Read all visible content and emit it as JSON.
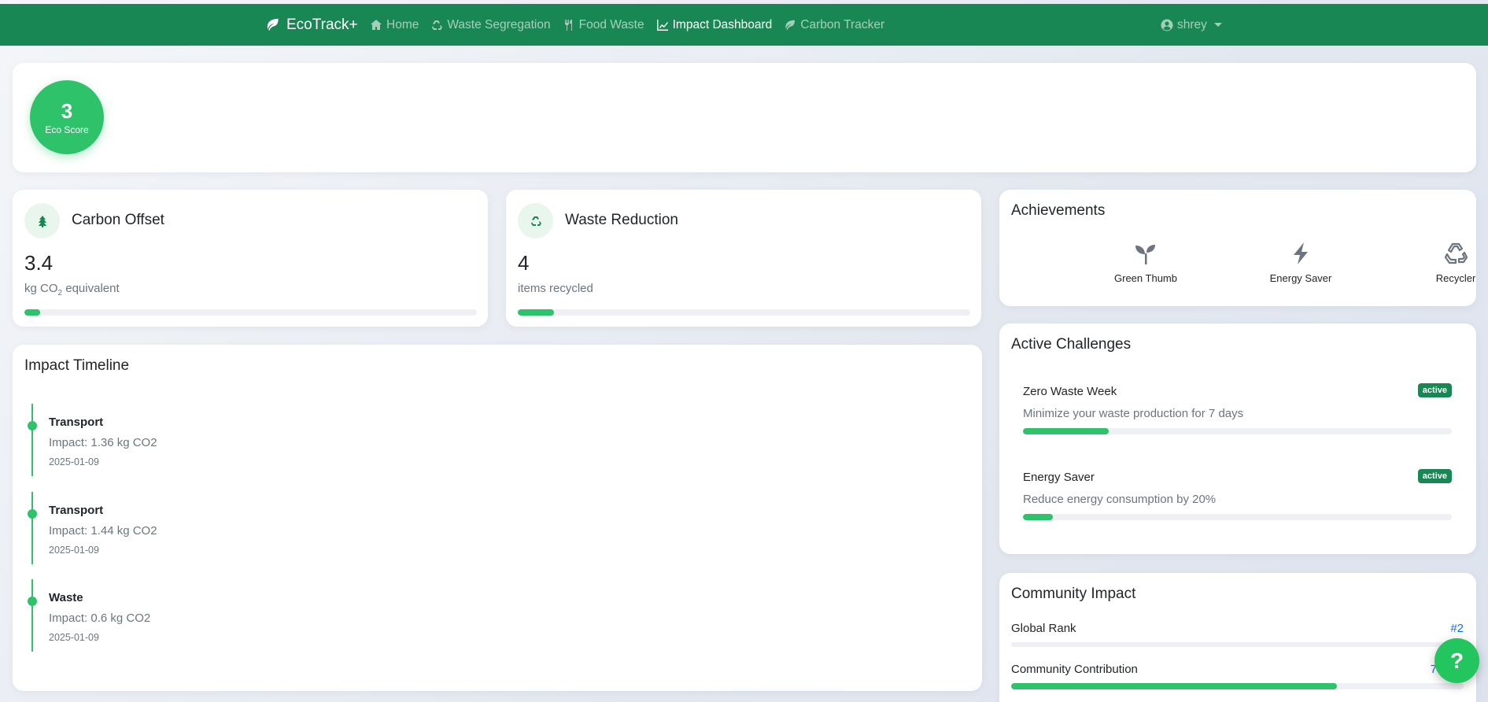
{
  "nav": {
    "brand": "EcoTrack+",
    "links": [
      {
        "label": "Home"
      },
      {
        "label": "Waste Segregation"
      },
      {
        "label": "Food Waste"
      },
      {
        "label": "Impact Dashboard"
      },
      {
        "label": "Carbon Tracker"
      }
    ],
    "user": "shrey"
  },
  "eco_score": {
    "value": "3",
    "label": "Eco Score"
  },
  "carbon_offset": {
    "title": "Carbon Offset",
    "value": "3.4",
    "unit_prefix": "kg CO",
    "unit_sub": "2",
    "unit_suffix": " equivalent",
    "progress_fraction": 0.034
  },
  "waste_reduction": {
    "title": "Waste Reduction",
    "value": "4",
    "unit": "items recycled",
    "progress_fraction": 0.08
  },
  "achievements": {
    "title": "Achievements",
    "items": [
      {
        "label": "Green Thumb",
        "icon": "seedling-icon"
      },
      {
        "label": "Energy Saver",
        "icon": "bolt-icon"
      },
      {
        "label": "Recycler",
        "icon": "recycle-icon"
      }
    ]
  },
  "timeline": {
    "title": "Impact Timeline",
    "items": [
      {
        "title": "Transport",
        "impact": "Impact: 1.36 kg CO2",
        "date": "2025-01-09"
      },
      {
        "title": "Transport",
        "impact": "Impact: 1.44 kg CO2",
        "date": "2025-01-09"
      },
      {
        "title": "Waste",
        "impact": "Impact: 0.6 kg CO2",
        "date": "2025-01-09"
      }
    ]
  },
  "challenges": {
    "title": "Active Challenges",
    "items": [
      {
        "name": "Zero Waste Week",
        "status": "active",
        "description": "Minimize your waste production for 7 days",
        "progress_fraction": 0.2
      },
      {
        "name": "Energy Saver",
        "status": "active",
        "description": "Reduce energy consumption by 20%",
        "progress_fraction": 0.07
      }
    ]
  },
  "community": {
    "title": "Community Impact",
    "global_rank_label": "Global Rank",
    "global_rank_value": "#2",
    "contribution_label": "Community Contribution",
    "contribution_value": "7",
    "contribution_fraction": 0.72
  },
  "help": {
    "label": "?"
  },
  "colors": {
    "brand": "#198754",
    "accent": "#2ec26b",
    "link": "#0d6efd"
  }
}
